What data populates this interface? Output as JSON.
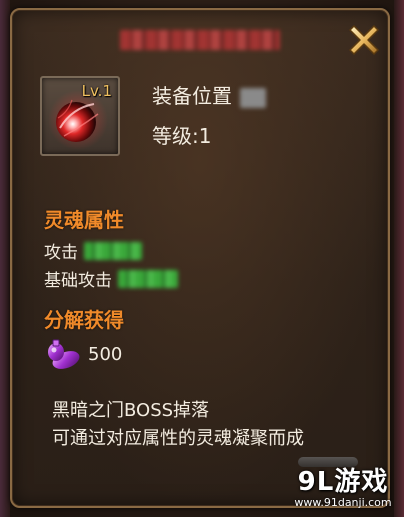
{
  "panel": {
    "title": "",
    "close_icon": "close-x-icon"
  },
  "item": {
    "icon": "soul-orb-icon",
    "level_badge": "Lv.1",
    "equip_slot_label": "装备位置",
    "level_text": "等级:1"
  },
  "soul_attributes": {
    "heading": "灵魂属性",
    "stats": [
      {
        "label": "攻击"
      },
      {
        "label": "基础攻击"
      }
    ]
  },
  "decompose": {
    "heading": "分解获得",
    "reward_icon": "purple-potion-icon",
    "reward_amount": "500"
  },
  "description": {
    "line1": "黑暗之门BOSS掉落",
    "line2": "可通过对应属性的灵魂凝聚而成"
  },
  "watermark": {
    "main": "9L游戏",
    "sub": "www.91danji.com"
  },
  "colors": {
    "section_heading": "#f08a2a",
    "body_text": "#f3ece0",
    "panel_border": "#8a6a44",
    "stat_value_blur": "#3aa83a",
    "title_blur": "#b23535",
    "level_badge": "#f0c060"
  }
}
